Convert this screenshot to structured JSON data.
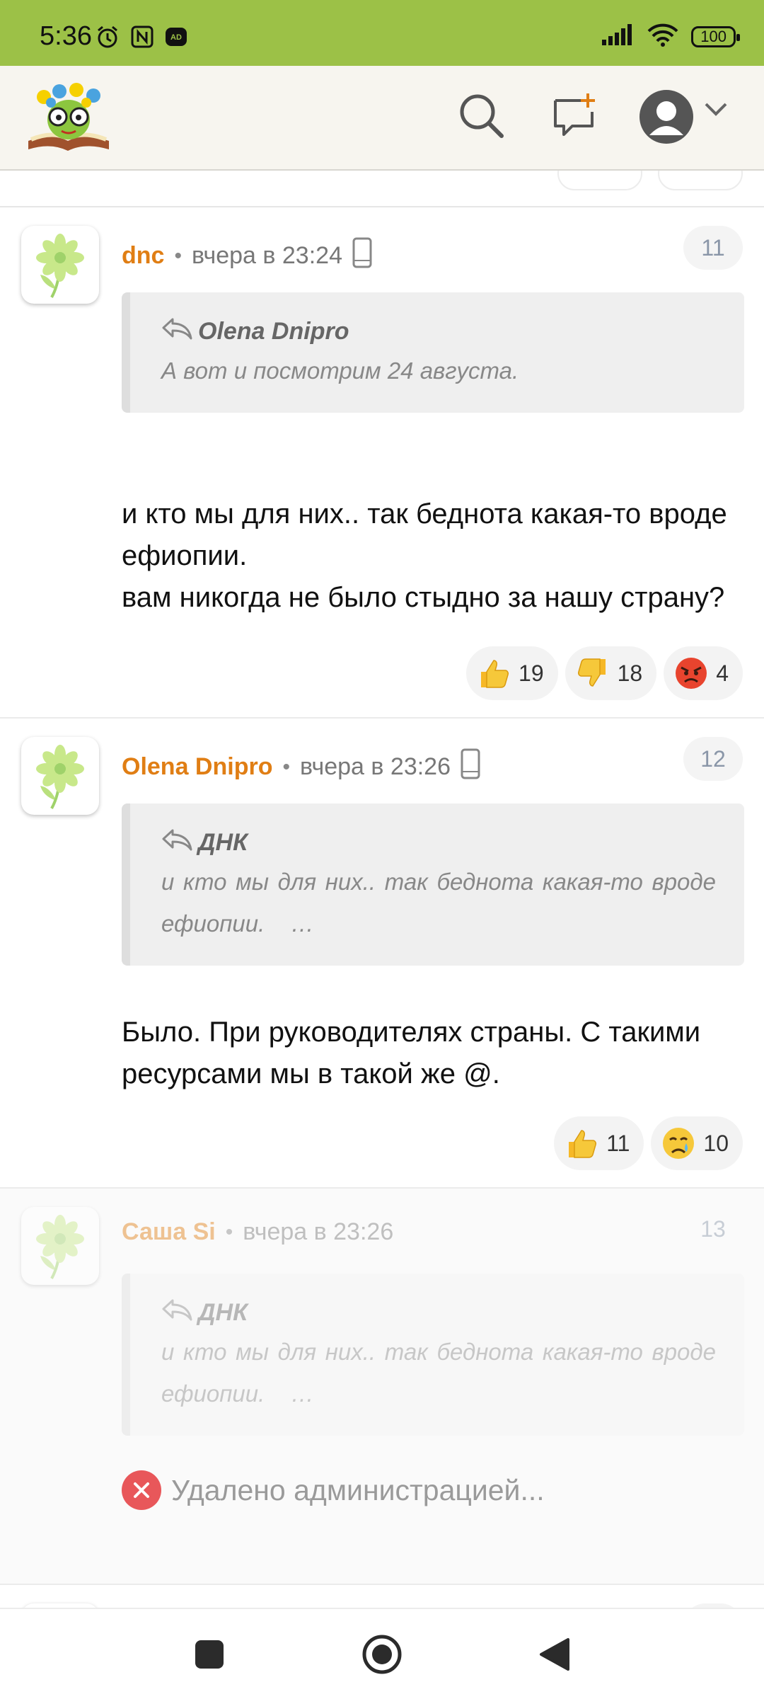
{
  "status_bar": {
    "time": "5:36",
    "battery": "100",
    "bg_color": "#9cc147"
  },
  "header": {
    "icons": [
      "logo-icon",
      "search-icon",
      "new-comment-icon",
      "account-icon",
      "chevron-down-icon"
    ]
  },
  "comments": [
    {
      "author": "dnc",
      "time": "вчера в 23:24",
      "device": "phone-icon",
      "number": "11",
      "quote": {
        "author": "Olena Dnipro",
        "text": "А вот и посмотрим 24 августа."
      },
      "text": "и кто мы для них.. так беднота какая-то вроде ефиопии.\nвам никогда не было стыдно за нашу страну?",
      "reactions": [
        {
          "icon": "thumbs-up-icon",
          "count": "19"
        },
        {
          "icon": "thumbs-down-icon",
          "count": "18"
        },
        {
          "icon": "angry-face-icon",
          "count": "4"
        }
      ]
    },
    {
      "author": "Olena Dnipro",
      "time": "вчера в 23:26",
      "device": "phone-icon",
      "number": "12",
      "quote": {
        "author": "ДНК",
        "text": "и кто мы для них.. так беднота какая-то вроде ефиопии.    …"
      },
      "text": "Было. При руководителях страны. С такими ресурсами мы в такой же @.",
      "reactions": [
        {
          "icon": "thumbs-up-icon",
          "count": "11"
        },
        {
          "icon": "crying-face-icon",
          "count": "10"
        }
      ]
    },
    {
      "author": "Саша Si",
      "time": "вчера в 23:26",
      "number": "13",
      "quote": {
        "author": "ДНК",
        "text": "и кто мы для них.. так беднота какая-то вроде ефиопии.    …"
      },
      "deleted_text": "Удалено администрацией..."
    }
  ],
  "colors": {
    "author": "#e07e14",
    "accent_green": "#9cc147"
  }
}
